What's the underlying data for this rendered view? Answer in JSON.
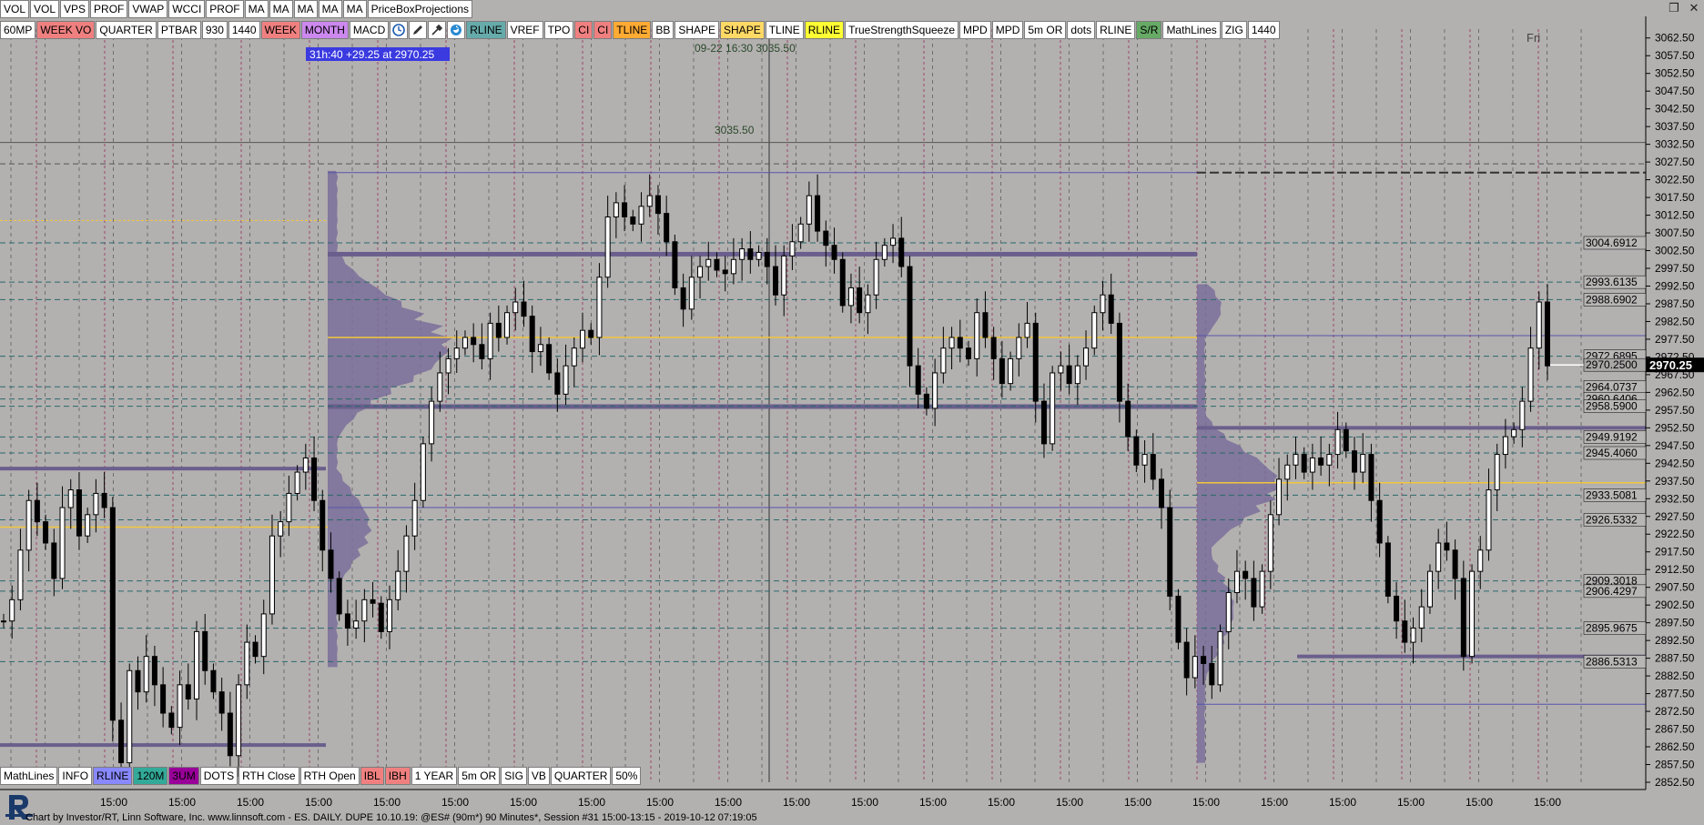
{
  "toolbar_top": [
    "VOL",
    "VOL",
    "VPS",
    "PROF",
    "VWAP",
    "WCCI",
    "PROF",
    "MA",
    "MA",
    "MA",
    "MA",
    "MA",
    "PriceBoxProjections"
  ],
  "toolbar_second": [
    {
      "label": "60MP",
      "bg": "#ffffff"
    },
    {
      "label": "WEEK VO",
      "bg": "#f08080"
    },
    {
      "label": "QUARTER",
      "bg": "#ffffff"
    },
    {
      "label": "PTBAR",
      "bg": "#ffffff"
    },
    {
      "label": "930",
      "bg": "#ffffff"
    },
    {
      "label": "1440",
      "bg": "#ffffff"
    },
    {
      "label": "WEEK",
      "bg": "#f08080"
    },
    {
      "label": "MONTH",
      "bg": "#cc88ee"
    },
    {
      "label": "MACD",
      "bg": "#ffffff"
    }
  ],
  "toolbar_second_icons": [
    "clock-icon",
    "pencil-icon",
    "eyedropper-icon",
    "refresh-icon"
  ],
  "toolbar_second_rest": [
    {
      "label": "RLINE",
      "bg": "#66aaaa"
    },
    {
      "label": "VREF",
      "bg": "#ffffff"
    },
    {
      "label": "TPO",
      "bg": "#ffffff"
    },
    {
      "label": "CI",
      "bg": "#f08080"
    },
    {
      "label": "CI",
      "bg": "#f08080"
    },
    {
      "label": "TLINE",
      "bg": "#ffaa33"
    },
    {
      "label": "BB",
      "bg": "#ffffff"
    },
    {
      "label": "SHAPE",
      "bg": "#ffffff"
    },
    {
      "label": "SHAPE",
      "bg": "#ffd966"
    },
    {
      "label": "TLINE",
      "bg": "#ffffff"
    },
    {
      "label": "RLINE",
      "bg": "#ffff33"
    },
    {
      "label": "TrueStrengthSqueeze",
      "bg": "#ffffff"
    },
    {
      "label": "MPD",
      "bg": "#ffffff"
    },
    {
      "label": "MPD",
      "bg": "#ffffff"
    },
    {
      "label": "5m OR",
      "bg": "#ffffff"
    },
    {
      "label": "dots",
      "bg": "#ffffff"
    },
    {
      "label": "RLINE",
      "bg": "#ffffff"
    },
    {
      "label": "S/R",
      "bg": "#66aa66"
    },
    {
      "label": "MathLines",
      "bg": "#ffffff"
    },
    {
      "label": "ZIG",
      "bg": "#ffffff"
    },
    {
      "label": "1440",
      "bg": "#ffffff"
    }
  ],
  "toolbar_bottom": [
    {
      "label": "MathLines",
      "bg": "#ffffff"
    },
    {
      "label": "INFO",
      "bg": "#ffffff"
    },
    {
      "label": "RLINE",
      "bg": "#8888ff"
    },
    {
      "label": "120M",
      "bg": "#33aa99"
    },
    {
      "label": "3UM",
      "bg": "#990099"
    },
    {
      "label": "DOTS",
      "bg": "#ffffff"
    },
    {
      "label": "RTH Close",
      "bg": "#ffffff"
    },
    {
      "label": "RTH Open",
      "bg": "#ffffff"
    },
    {
      "label": "IBL",
      "bg": "#f08080"
    },
    {
      "label": "IBH",
      "bg": "#f08080"
    },
    {
      "label": "1 YEAR",
      "bg": "#ffffff"
    },
    {
      "label": "5m OR",
      "bg": "#ffffff"
    },
    {
      "label": "SIG",
      "bg": "#ffffff"
    },
    {
      "label": "VB",
      "bg": "#ffffff"
    },
    {
      "label": "QUARTER",
      "bg": "#ffffff"
    },
    {
      "label": "50%",
      "bg": "#ffffff"
    }
  ],
  "countdown_label": "31h:40  +29.25 at 2970.25",
  "crosshair_label": "09-22 16:30  3035.50",
  "high_marker_label": "3035.50",
  "day_label": "Fri",
  "price_axis_ticks": [
    "3062.50",
    "3057.50",
    "3052.50",
    "3047.50",
    "3042.50",
    "3037.50",
    "3032.50",
    "3027.50",
    "3022.50",
    "3017.50",
    "3012.50",
    "3007.50",
    "3002.50",
    "2997.50",
    "2992.50",
    "2987.50",
    "2982.50",
    "2977.50",
    "2972.50",
    "2967.50",
    "2962.50",
    "2957.50",
    "2952.50",
    "2947.50",
    "2942.50",
    "2937.50",
    "2932.50",
    "2927.50",
    "2922.50",
    "2917.50",
    "2912.50",
    "2907.50",
    "2902.50",
    "2897.50",
    "2892.50",
    "2887.50",
    "2882.50",
    "2877.50",
    "2872.50",
    "2867.50",
    "2862.50",
    "2857.50",
    "2852.50"
  ],
  "level_labels": [
    "3004.6912",
    "2993.6135",
    "2988.6902",
    "2972.6895",
    "2970.2500",
    "2964.0737",
    "2960.6406",
    "2958.5900",
    "2949.9192",
    "2945.4060",
    "2933.5081",
    "2926.5332",
    "2909.3018",
    "2906.4297",
    "2895.9675",
    "2886.5313"
  ],
  "current_price_label": "2970.25",
  "time_axis_labels": [
    "15:00",
    "15:00",
    "15:00",
    "15:00",
    "15:00",
    "15:00",
    "15:00",
    "15:00",
    "15:00",
    "15:00",
    "15:00",
    "15:00",
    "15:00",
    "15:00",
    "15:00",
    "15:00",
    "15:00",
    "15:00",
    "15:00",
    "15:00",
    "15:00",
    "15:00",
    "15:00"
  ],
  "status_line": "Chart by Investor/RT, Linn Software, Inc. www.linnsoft.com - ES. DAILY. DUPE   10.10.19: @ES# (90m*) 90 Minutes*, Session #31 15:00-13:15 - 2019-10-12 07:19:05",
  "colors": {
    "background": "#b3b0b0",
    "profile": "#7a6f9a",
    "poc_line": "#f2c83c",
    "value_area_line": "#6a5f8c",
    "session_divider": "#9a4a6a",
    "level_dash": "#2a6a6a"
  },
  "chart_data": {
    "type": "candlestick",
    "symbol": "@ES#",
    "interval": "90 Minutes",
    "ylim": [
      2852.5,
      3065
    ],
    "close_path": [
      2898,
      2904,
      2918,
      2932,
      2926,
      2920,
      2910,
      2930,
      2935,
      2922,
      2928,
      2934,
      2930,
      2870,
      2858,
      2884,
      2878,
      2888,
      2880,
      2872,
      2868,
      2880,
      2876,
      2895,
      2884,
      2878,
      2872,
      2860,
      2880,
      2892,
      2888,
      2900,
      2922,
      2926,
      2934,
      2940,
      2944,
      2932,
      2918,
      2910,
      2900,
      2896,
      2898,
      2904,
      2903,
      2895,
      2904,
      2912,
      2922,
      2932,
      2948,
      2960,
      2968,
      2972,
      2975,
      2978,
      2976,
      2972,
      2982,
      2978,
      2985,
      2988,
      2984,
      2974,
      2976,
      2968,
      2962,
      2970,
      2975,
      2980,
      2978,
      2995,
      3012,
      3016,
      3012,
      3010,
      3015,
      3018,
      3013,
      3005,
      2992,
      2986,
      2995,
      2998,
      3000,
      2997,
      2996,
      3000,
      3003,
      3000,
      3002,
      2998,
      2990,
      3001,
      3005,
      3010,
      3018,
      3008,
      3004,
      3000,
      2987,
      2992,
      2985,
      2990,
      3000,
      3004,
      3006,
      2998,
      2970,
      2962,
      2958,
      2968,
      2975,
      2978,
      2975,
      2972,
      2985,
      2978,
      2972,
      2965,
      2972,
      2978,
      2982,
      2960,
      2948,
      2968,
      2970,
      2965,
      2970,
      2975,
      2985,
      2990,
      2982,
      2960,
      2950,
      2942,
      2945,
      2938,
      2930,
      2905,
      2892,
      2882,
      2888,
      2886,
      2880,
      2895,
      2906,
      2912,
      2910,
      2902,
      2912,
      2928,
      2938,
      2942,
      2945,
      2940,
      2944,
      2942,
      2945,
      2952,
      2946,
      2940,
      2945,
      2932,
      2920,
      2905,
      2898,
      2892,
      2896,
      2902,
      2912,
      2920,
      2918,
      2910,
      2888,
      2912,
      2918,
      2935,
      2945,
      2950,
      2952,
      2960,
      2975,
      2988,
      2970
    ]
  }
}
